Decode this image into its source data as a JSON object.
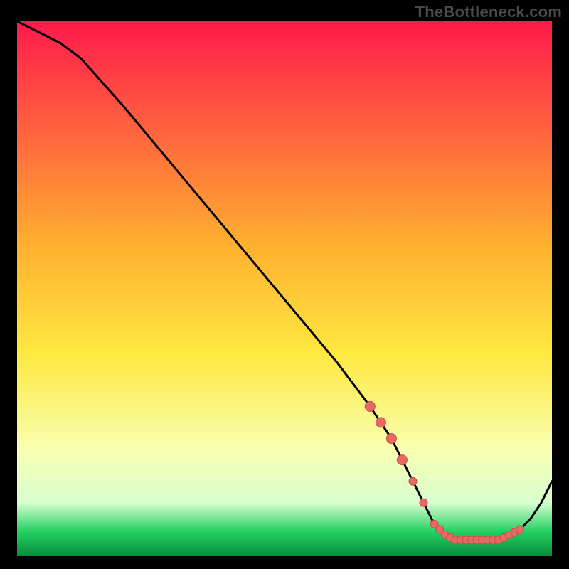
{
  "watermark": "TheBottleneck.com",
  "colors": {
    "bg": "#000000",
    "curve": "#000000",
    "marker_fill": "#e46a63",
    "marker_stroke": "#c94e47",
    "grad_top": "#ff1a4b",
    "grad_mid1": "#ffb030",
    "grad_mid2": "#ffe840",
    "grad_mid3": "#f8ffb0",
    "grad_green": "#20d060",
    "grad_bottom": "#0a8a3a"
  },
  "chart_data": {
    "type": "line",
    "title": "",
    "xlabel": "",
    "ylabel": "",
    "xlim": [
      0,
      100
    ],
    "ylim": [
      0,
      100
    ],
    "series": [
      {
        "name": "bottleneck-curve",
        "x": [
          0,
          4,
          8,
          12,
          20,
          30,
          40,
          50,
          60,
          66,
          70,
          72,
          74,
          76,
          78,
          80,
          82,
          84,
          86,
          88,
          90,
          92,
          94,
          96,
          98,
          100
        ],
        "y": [
          100,
          98,
          96,
          93,
          84,
          72,
          60,
          48,
          36,
          28,
          22,
          18,
          14,
          10,
          6,
          4,
          3,
          3,
          3,
          3,
          3,
          4,
          5,
          7,
          10,
          14
        ]
      }
    ],
    "markers": {
      "name": "highlighted-range",
      "x": [
        66,
        68,
        70,
        72,
        74,
        76,
        78,
        79,
        80,
        81,
        82,
        83,
        84,
        85,
        86,
        87,
        88,
        89,
        90,
        91,
        92,
        93,
        94
      ],
      "y": [
        28,
        25,
        22,
        18,
        14,
        10,
        6,
        5,
        4,
        3.5,
        3,
        3,
        3,
        3,
        3,
        3,
        3,
        3,
        3,
        3.5,
        4,
        4.5,
        5
      ]
    }
  }
}
